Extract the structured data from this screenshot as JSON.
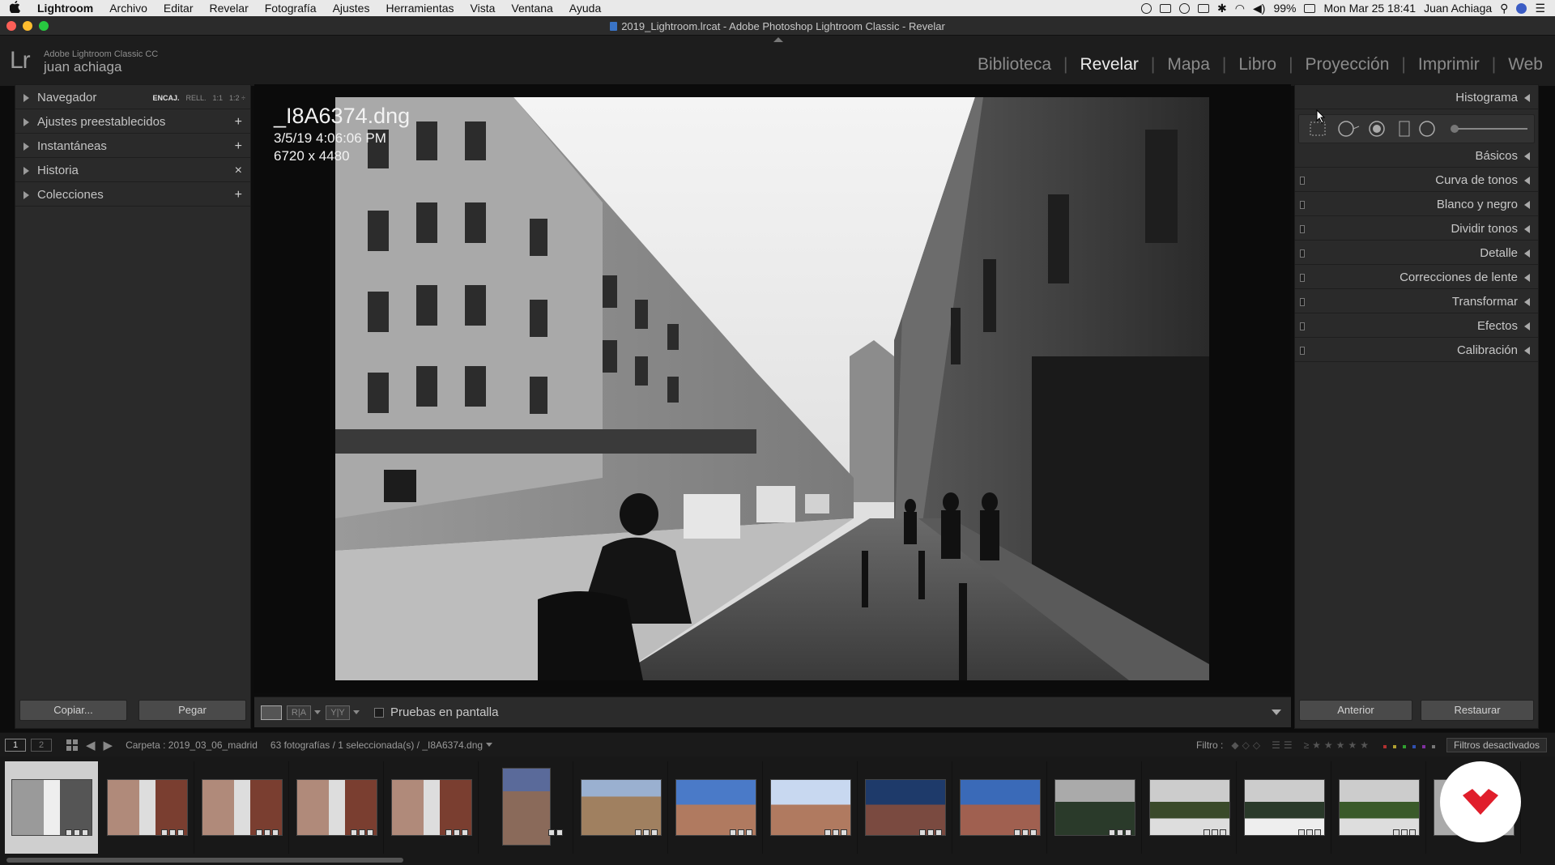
{
  "menubar": {
    "apple": "",
    "app": "Lightroom",
    "items": [
      "Archivo",
      "Editar",
      "Revelar",
      "Fotografía",
      "Ajustes",
      "Herramientas",
      "Vista",
      "Ventana",
      "Ayuda"
    ],
    "battery": "99%",
    "datetime": "Mon Mar 25  18:41",
    "user": "Juan Achiaga"
  },
  "window": {
    "title": "2019_Lightroom.lrcat - Adobe Photoshop Lightroom Classic - Revelar"
  },
  "identity": {
    "logo": "Lr",
    "product": "Adobe Lightroom Classic CC",
    "user": "juan achiaga"
  },
  "modules": {
    "items": [
      "Biblioteca",
      "Revelar",
      "Mapa",
      "Libro",
      "Proyección",
      "Imprimir",
      "Web"
    ],
    "active": "Revelar"
  },
  "left_panel": {
    "navigator": {
      "label": "Navegador",
      "options": [
        "ENCAJ.",
        "RELL.",
        "1:1",
        "1:2 ÷"
      ]
    },
    "presets": {
      "label": "Ajustes preestablecidos",
      "action": "+"
    },
    "snapshots": {
      "label": "Instantáneas",
      "action": "+"
    },
    "history": {
      "label": "Historia",
      "action": "×"
    },
    "collections": {
      "label": "Colecciones",
      "action": "+"
    },
    "copy_button": "Copiar...",
    "paste_button": "Pegar"
  },
  "image_info": {
    "filename": "_I8A6374.dng",
    "datetime": "3/5/19 4:06:06 PM",
    "dimensions": "6720 x 4480"
  },
  "toolbar": {
    "view_before_after_1": "R|A",
    "view_before_after_2": "Y|Y",
    "soft_proof_label": "Pruebas en pantalla"
  },
  "right_panel": {
    "histogram": "Histograma",
    "sections": [
      "Básicos",
      "Curva de tonos",
      "Blanco y negro",
      "Dividir tonos",
      "Detalle",
      "Correcciones de lente",
      "Transformar",
      "Efectos",
      "Calibración"
    ],
    "previous_button": "Anterior",
    "reset_button": "Restaurar"
  },
  "filmstrip_bar": {
    "screen1": "1",
    "screen2": "2",
    "folder": "Carpeta : 2019_03_06_madrid",
    "count": "63 fotografías / 1 seleccionada(s) / _I8A6374.dng",
    "filter_label": "Filtro :",
    "filter_button": "Filtros desactivados"
  },
  "colors": {
    "accent_logo": "#e01e2b",
    "selected_cell": "#cfcfcf"
  }
}
